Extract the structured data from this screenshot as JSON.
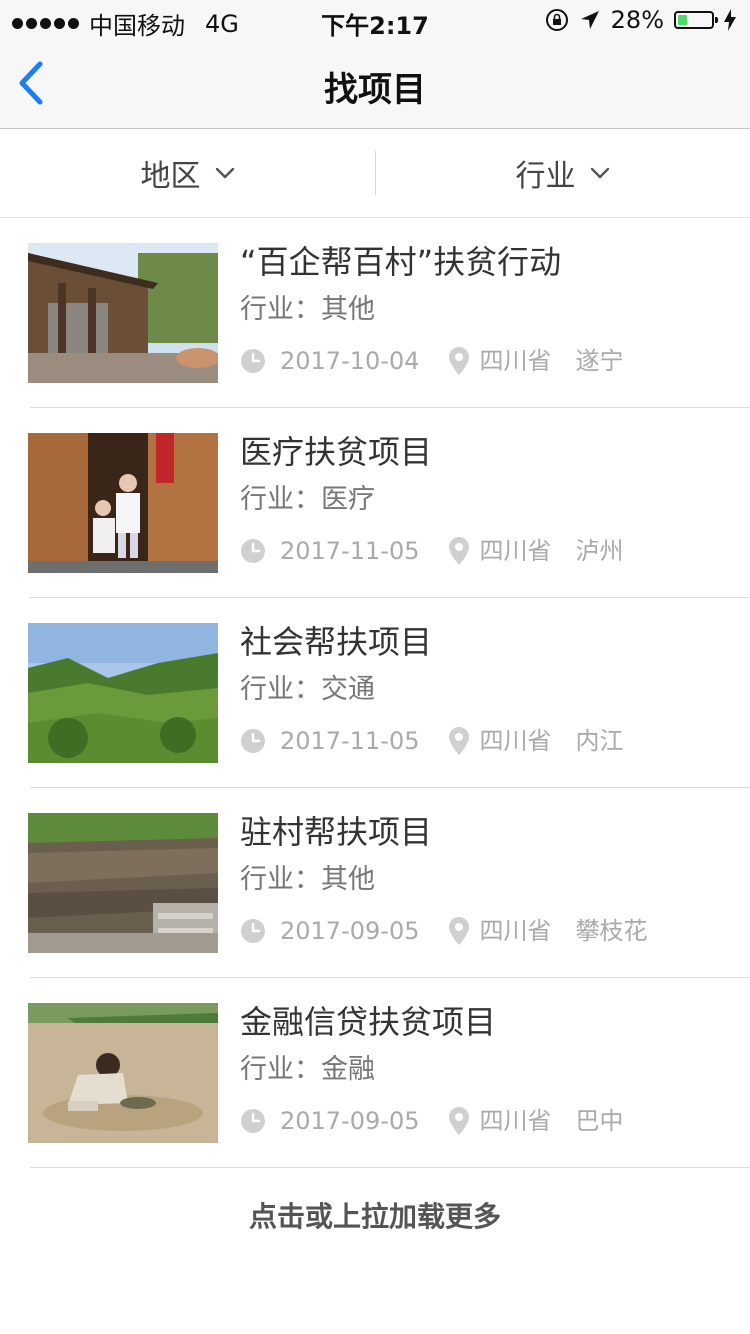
{
  "status_bar": {
    "carrier": "中国移动",
    "network": "4G",
    "time": "下午2:17",
    "battery_percent": "28%",
    "battery_level": 0.28
  },
  "nav": {
    "title": "找项目",
    "accent_color": "#1a7ff0"
  },
  "filters": [
    {
      "label": "地区"
    },
    {
      "label": "行业"
    }
  ],
  "projects": [
    {
      "title": "“百企帮百村”扶贫行动",
      "industry": "行业：其他",
      "date": "2017-10-04",
      "province": "四川省",
      "city": "遂宁"
    },
    {
      "title": "医疗扶贫项目",
      "industry": "行业：医疗",
      "date": "2017-11-05",
      "province": "四川省",
      "city": "泸州"
    },
    {
      "title": "社会帮扶项目",
      "industry": "行业：交通",
      "date": "2017-11-05",
      "province": "四川省",
      "city": "内江"
    },
    {
      "title": "驻村帮扶项目",
      "industry": "行业：其他",
      "date": "2017-09-05",
      "province": "四川省",
      "city": "攀枝花"
    },
    {
      "title": "金融信贷扶贫项目",
      "industry": "行业：金融",
      "date": "2017-09-05",
      "province": "四川省",
      "city": "巴中"
    }
  ],
  "load_more": "点击或上拉加载更多"
}
